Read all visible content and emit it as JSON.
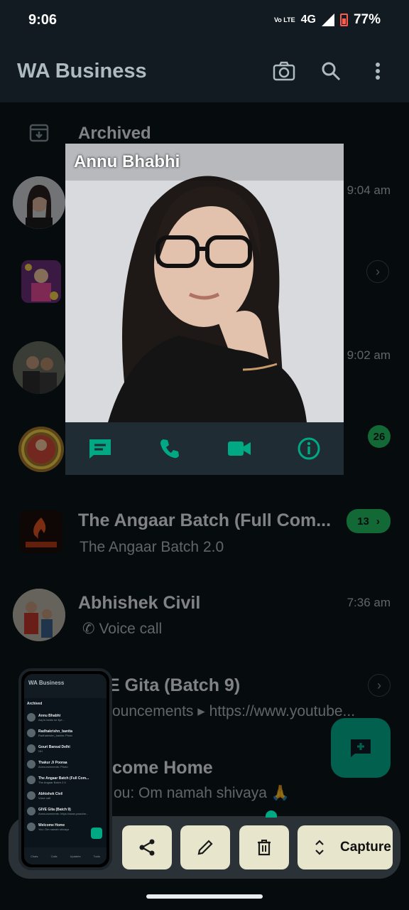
{
  "status_bar": {
    "time": "9:06",
    "volte": "Vo LTE",
    "network": "4G",
    "battery": "77%"
  },
  "app_bar": {
    "title": "WA Business",
    "icons": [
      "camera-icon",
      "search-icon",
      "more-vert-icon"
    ]
  },
  "archived": {
    "label": "Archived"
  },
  "chats": [
    {
      "name": "Annu Bhabhi",
      "preview": "",
      "time": "9:04 am"
    },
    {
      "name": "",
      "preview": "",
      "time": ""
    },
    {
      "name": "",
      "preview": "",
      "time": "9:02 am"
    },
    {
      "name": "",
      "preview": "",
      "time": "",
      "unread": "26"
    },
    {
      "name": "The Angaar Batch (Full Com...",
      "preview": "The Angaar Batch 2.0",
      "time": "",
      "unread": "13"
    },
    {
      "name": "Abhishek Civil",
      "preview": "Voice call",
      "time": "7:36 am"
    },
    {
      "name": "E Gita (Batch 9)",
      "preview": "ouncements ▸ https://www.youtube...",
      "time": ""
    },
    {
      "name": "come Home",
      "preview": "ou: Om namah shivaya 🙏",
      "time": ""
    }
  ],
  "popup": {
    "contact_name": "Annu Bhabhi",
    "actions": [
      "message-icon",
      "call-icon",
      "video-call-icon",
      "info-icon"
    ]
  },
  "thumbnail": {
    "title": "WA Business",
    "archived": "Archived",
    "rows": [
      {
        "name": "Annu Bhabhi",
        "preview": "Aaj to laddu ke liye...",
        "time": "9:04 am"
      },
      {
        "name": "Radhakrishn_bantta",
        "preview": "Radhakrishn_bantta: Photo",
        "time": ""
      },
      {
        "name": "Gouri Bansal Delhi",
        "preview": "NH",
        "time": "9:02 am"
      },
      {
        "name": "Thakur Ji Pooraa",
        "preview": "Announcements: Photo",
        "time": ""
      },
      {
        "name": "The Angaar Batch (Full Com...",
        "preview": "The Angaar Batch 2.0",
        "time": ""
      },
      {
        "name": "Abhishek Civil",
        "preview": "Voice call",
        "time": "7:36 am"
      },
      {
        "name": "GIVE Gita (Batch 9)",
        "preview": "Announcements: https://www.youtube...",
        "time": ""
      },
      {
        "name": "Welcome Home",
        "preview": "You: Om namah shivaya",
        "time": ""
      }
    ],
    "nav": [
      "Chats",
      "Calls",
      "Updates",
      "Tools"
    ]
  },
  "capture_toolbar": {
    "capture_label": "Capture",
    "buttons": [
      "share-icon",
      "edit-icon",
      "delete-icon",
      "expand-icon"
    ]
  },
  "colors": {
    "background": "#0b141a",
    "bar": "#111b21",
    "accent": "#00a884",
    "badge": "#21c063",
    "toolbar_button": "#e8e5cd"
  }
}
